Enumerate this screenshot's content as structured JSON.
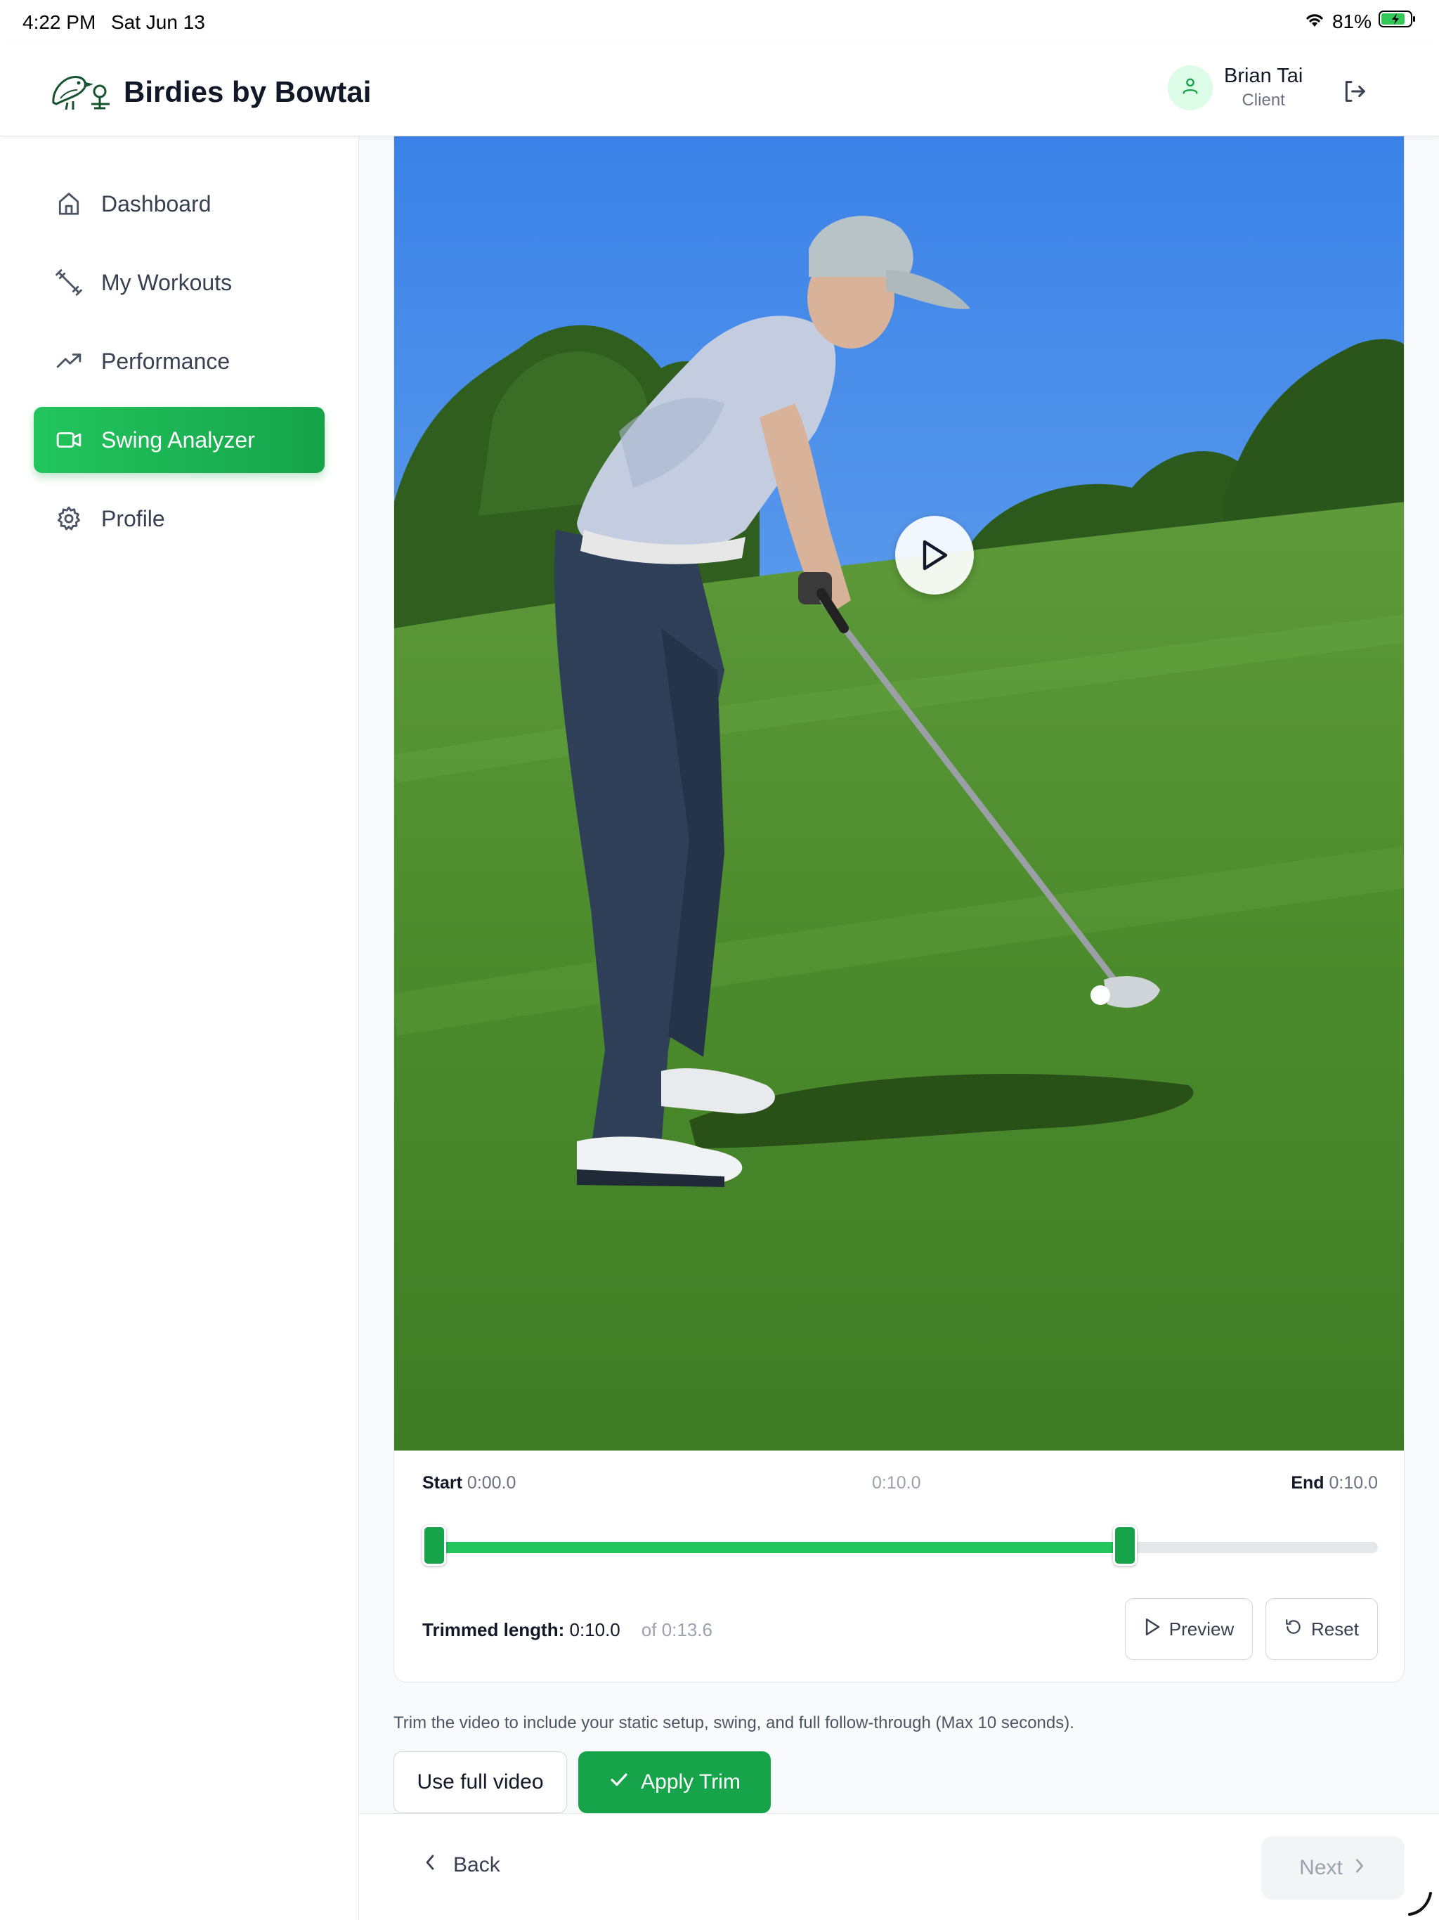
{
  "status_bar": {
    "time": "4:22 PM",
    "date": "Sat Jun 13",
    "battery": "81%"
  },
  "header": {
    "brand": "Birdies by Bowtai",
    "user_name": "Brian Tai",
    "user_role": "Client"
  },
  "sidebar": {
    "items": [
      {
        "label": "Dashboard",
        "icon": "home-icon",
        "active": false
      },
      {
        "label": "My Workouts",
        "icon": "dumbbell-icon",
        "active": false
      },
      {
        "label": "Performance",
        "icon": "trending-up-icon",
        "active": false
      },
      {
        "label": "Swing Analyzer",
        "icon": "video-icon",
        "active": true
      },
      {
        "label": "Profile",
        "icon": "gear-icon",
        "active": false
      }
    ]
  },
  "trim": {
    "start_label": "Start",
    "start_value": "0:00.0",
    "mid_value": "0:10.0",
    "end_label": "End",
    "end_value": "0:10.0",
    "range_start_fraction": 0.0,
    "range_end_fraction": 0.735,
    "length_label": "Trimmed length:",
    "length_value": "0:10.0",
    "of_total": "of 0:13.6",
    "preview_label": "Preview",
    "reset_label": "Reset"
  },
  "hint": "Trim the video to include your static setup, swing, and full follow-through (Max 10 seconds).",
  "actions": {
    "use_full": "Use full video",
    "apply": "Apply Trim"
  },
  "footer": {
    "back": "Back",
    "next": "Next"
  },
  "colors": {
    "accent": "#16a34a",
    "accent_light": "#22c55e",
    "avatar_bg": "#dcfce7"
  }
}
